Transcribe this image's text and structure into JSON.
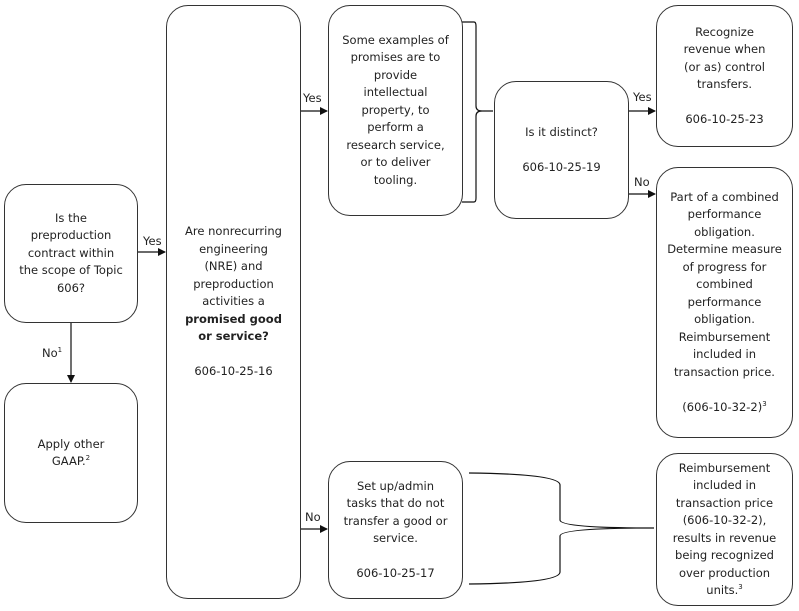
{
  "nodes": {
    "scope": {
      "text": "Is the preproduction contract within the scope of Topic 606?"
    },
    "other_gaap": {
      "text": "Apply other GAAP.",
      "footnote": "2"
    },
    "nre": {
      "text_before": "Are nonrecurring engineering (NRE) and preproduction activities a",
      "bold": "promised good or service?",
      "ref": "606-10-25-16"
    },
    "examples": {
      "text": "Some examples of promises are to provide intellectual property, to perform a research service, or to deliver tooling."
    },
    "distinct": {
      "text": "Is it distinct?",
      "ref": "606-10-25-19"
    },
    "recognize": {
      "text": "Recognize revenue when (or as) control transfers.",
      "ref": "606-10-25-23"
    },
    "combined": {
      "text1": "Part of a combined performance obligation.",
      "text2": "Determine measure of progress for combined performance obligation.",
      "text3": "Reimbursement included in transaction price.",
      "ref": "(606-10-32-2)",
      "footnote": "3"
    },
    "setup": {
      "text": "Set up/admin tasks that do not transfer a good or service.",
      "ref": "606-10-25-17"
    },
    "reimbursement": {
      "text": "Reimbursement included in transaction price (606-10-32-2), results in revenue being recognized over production units.",
      "footnote": "3"
    }
  },
  "edges": {
    "scope_yes": "Yes",
    "scope_no": "No",
    "scope_no_footnote": "1",
    "nre_yes": "Yes",
    "nre_no": "No",
    "distinct_yes": "Yes",
    "distinct_no": "No"
  }
}
